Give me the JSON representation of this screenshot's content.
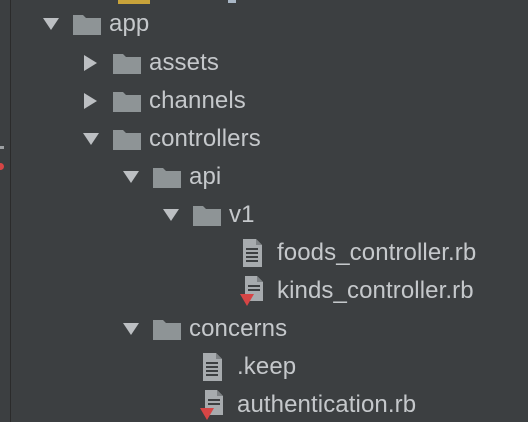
{
  "project_tree": {
    "items": [
      {
        "label": "app",
        "kind": "folder",
        "expanded": true,
        "icon": "folder-icon"
      },
      {
        "label": "assets",
        "kind": "folder",
        "expanded": false,
        "icon": "folder-icon"
      },
      {
        "label": "channels",
        "kind": "folder",
        "expanded": false,
        "icon": "folder-icon"
      },
      {
        "label": "controllers",
        "kind": "folder",
        "expanded": true,
        "icon": "folder-icon"
      },
      {
        "label": "api",
        "kind": "folder",
        "expanded": true,
        "icon": "folder-icon"
      },
      {
        "label": "v1",
        "kind": "folder",
        "expanded": true,
        "icon": "folder-icon"
      },
      {
        "label": "foods_controller.rb",
        "kind": "file",
        "icon": "text-file-icon"
      },
      {
        "label": "kinds_controller.rb",
        "kind": "file",
        "icon": "ruby-file-icon"
      },
      {
        "label": "concerns",
        "kind": "folder",
        "expanded": true,
        "icon": "folder-icon"
      },
      {
        "label": ".keep",
        "kind": "file",
        "icon": "text-file-icon"
      },
      {
        "label": "authentication.rb",
        "kind": "file",
        "icon": "ruby-file-icon"
      }
    ]
  },
  "colors": {
    "background": "#3c3f41",
    "text": "#c5c8cb",
    "folder": "#8e9496",
    "arrow": "#bcbfc2",
    "file": "#a7abae",
    "ruby": "#d64545"
  }
}
